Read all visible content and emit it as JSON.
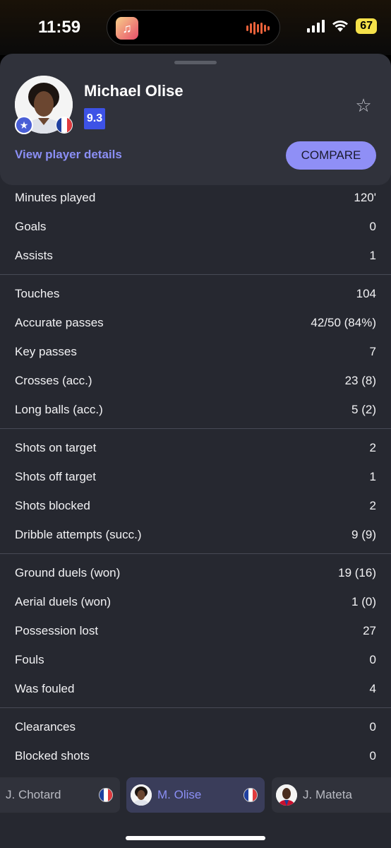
{
  "status": {
    "time": "11:59",
    "battery": "67"
  },
  "header": {
    "player_name": "Michael Olise",
    "rating": "9.3",
    "details_link": "View player details",
    "compare_label": "COMPARE"
  },
  "colors": {
    "accent": "#8b8ff5",
    "rating_bg": "#3d52e6",
    "background": "#262830"
  },
  "stats": [
    [
      {
        "label": "Minutes played",
        "value": "120'"
      },
      {
        "label": "Goals",
        "value": "0"
      },
      {
        "label": "Assists",
        "value": "1"
      }
    ],
    [
      {
        "label": "Touches",
        "value": "104"
      },
      {
        "label": "Accurate passes",
        "value": "42/50 (84%)"
      },
      {
        "label": "Key passes",
        "value": "7"
      },
      {
        "label": "Crosses (acc.)",
        "value": "23 (8)"
      },
      {
        "label": "Long balls (acc.)",
        "value": "5 (2)"
      }
    ],
    [
      {
        "label": "Shots on target",
        "value": "2"
      },
      {
        "label": "Shots off target",
        "value": "1"
      },
      {
        "label": "Shots blocked",
        "value": "2"
      },
      {
        "label": "Dribble attempts (succ.)",
        "value": "9 (9)"
      }
    ],
    [
      {
        "label": "Ground duels (won)",
        "value": "19 (16)"
      },
      {
        "label": "Aerial duels (won)",
        "value": "1 (0)"
      },
      {
        "label": "Possession lost",
        "value": "27"
      },
      {
        "label": "Fouls",
        "value": "0"
      },
      {
        "label": "Was fouled",
        "value": "4"
      }
    ],
    [
      {
        "label": "Clearances",
        "value": "0"
      },
      {
        "label": "Blocked shots",
        "value": "0"
      }
    ]
  ],
  "player_tabs": [
    {
      "name": "J. Chotard"
    },
    {
      "name": "M. Olise"
    },
    {
      "name": "J. Mateta"
    }
  ]
}
